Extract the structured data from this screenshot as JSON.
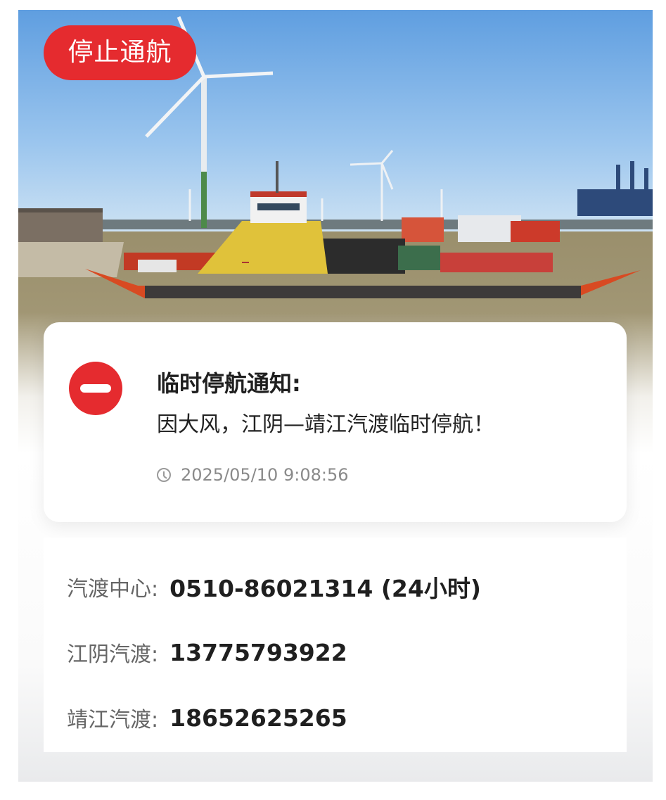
{
  "status": {
    "label": "停止通航",
    "color": "#e52b2f"
  },
  "notice": {
    "icon": "stop-icon",
    "title": "临时停航通知:",
    "message": "因大风，江阴—靖江汽渡临时停航！",
    "time_icon": "clock-icon",
    "timestamp": "2025/05/10 9:08:56"
  },
  "contacts": [
    {
      "label": "汽渡中心:",
      "value": "0510-86021314 (24小时)"
    },
    {
      "label": "江阴汽渡:",
      "value": "13775793922"
    },
    {
      "label": "靖江汽渡:",
      "value": "18652625265"
    }
  ]
}
